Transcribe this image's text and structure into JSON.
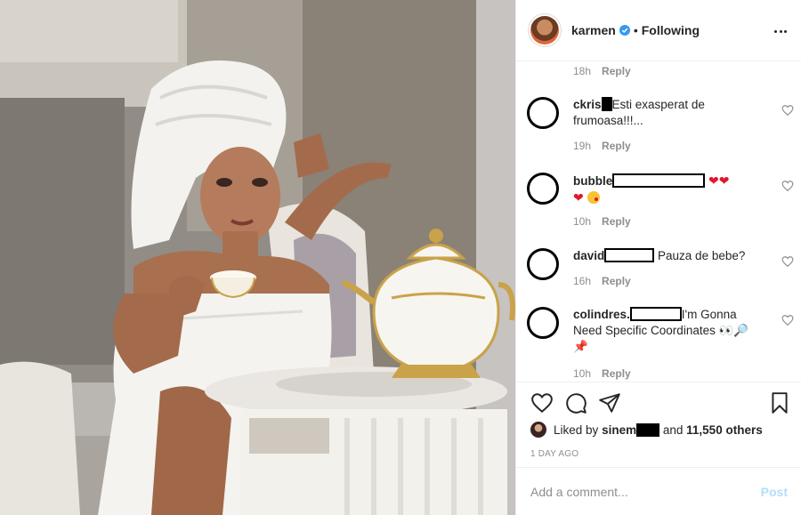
{
  "header": {
    "username": "karmen",
    "separator": "•",
    "follow_state": "Following"
  },
  "comments": {
    "top_meta": {
      "time": "18h",
      "reply": "Reply"
    },
    "items": [
      {
        "user": "ckris",
        "text": "Esti exasperat de frumoasa!!!...",
        "time": "19h",
        "reply": "Reply"
      },
      {
        "user": "bubble",
        "text": "",
        "time": "10h",
        "reply": "Reply"
      },
      {
        "user": "david",
        "text": "Pauza de bebe?",
        "time": "16h",
        "reply": "Reply"
      },
      {
        "user": "colindres.",
        "text": "I'm Gonna Need Specific Coordinates",
        "time": "10h",
        "reply": "Reply"
      }
    ]
  },
  "likes": {
    "prefix": "Liked by",
    "user": "sinem",
    "conj": "and",
    "others": "11,550 others"
  },
  "time_ago": "1 DAY AGO",
  "add_comment": {
    "placeholder": "Add a comment...",
    "post_label": "Post"
  },
  "colors": {
    "verified": "#3897f0",
    "heart_emoji": "#e0182d",
    "post_disabled": "#b2dffc"
  }
}
